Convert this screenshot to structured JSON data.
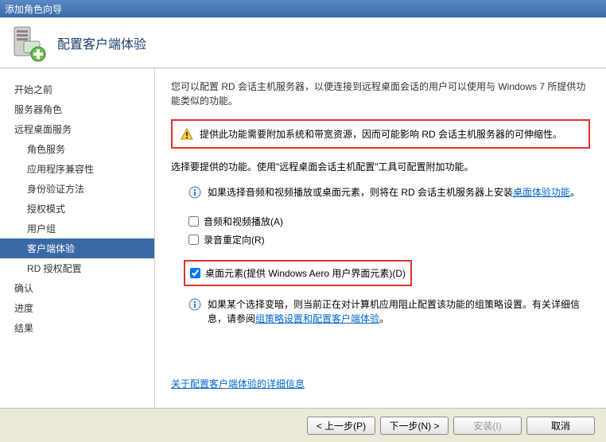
{
  "window": {
    "title": "添加角色向导"
  },
  "header": {
    "title": "配置客户端体验"
  },
  "sidebar": {
    "items": [
      {
        "label": "开始之前",
        "indent": 0
      },
      {
        "label": "服务器角色",
        "indent": 0
      },
      {
        "label": "远程桌面服务",
        "indent": 0
      },
      {
        "label": "角色服务",
        "indent": 1
      },
      {
        "label": "应用程序兼容性",
        "indent": 1
      },
      {
        "label": "身份验证方法",
        "indent": 1
      },
      {
        "label": "授权模式",
        "indent": 1
      },
      {
        "label": "用户组",
        "indent": 1
      },
      {
        "label": "客户端体验",
        "indent": 1,
        "selected": true
      },
      {
        "label": "RD 授权配置",
        "indent": 1
      },
      {
        "label": "确认",
        "indent": 0
      },
      {
        "label": "进度",
        "indent": 0
      },
      {
        "label": "结果",
        "indent": 0
      }
    ]
  },
  "content": {
    "intro": "您可以配置 RD 会话主机服务器，以便连接到远程桌面会话的用户可以使用与 Windows 7 所提供功能类似的功能。",
    "warning": "提供此功能需要附加系统和带宽资源，因而可能影响 RD 会话主机服务器的可伸缩性。",
    "select_text": "选择要提供的功能。使用\"远程桌面会话主机配置\"工具可配置附加功能。",
    "info1_prefix": "如果选择音频和视频播放或桌面元素，则将在 RD 会话主机服务器上安装",
    "info1_link": "桌面体验功能",
    "info1_suffix": "。",
    "checks": [
      {
        "label": "音频和视频播放(A)",
        "checked": false
      },
      {
        "label": "录音重定向(R)",
        "checked": false
      }
    ],
    "highlighted_check": {
      "label": "桌面元素(提供 Windows Aero 用户界面元素)(D)",
      "checked": true
    },
    "info2_prefix": "如果某个选择变暗，则当前正在对计算机应用阻止配置该功能的组策略设置。有关详细信息，请参阅",
    "info2_link": "组策略设置和配置客户端体验",
    "info2_suffix": "。",
    "more_link": "关于配置客户端体验的详细信息"
  },
  "buttons": {
    "prev": "< 上一步(P)",
    "next": "下一步(N) >",
    "install": "安装(I)",
    "cancel": "取消"
  }
}
